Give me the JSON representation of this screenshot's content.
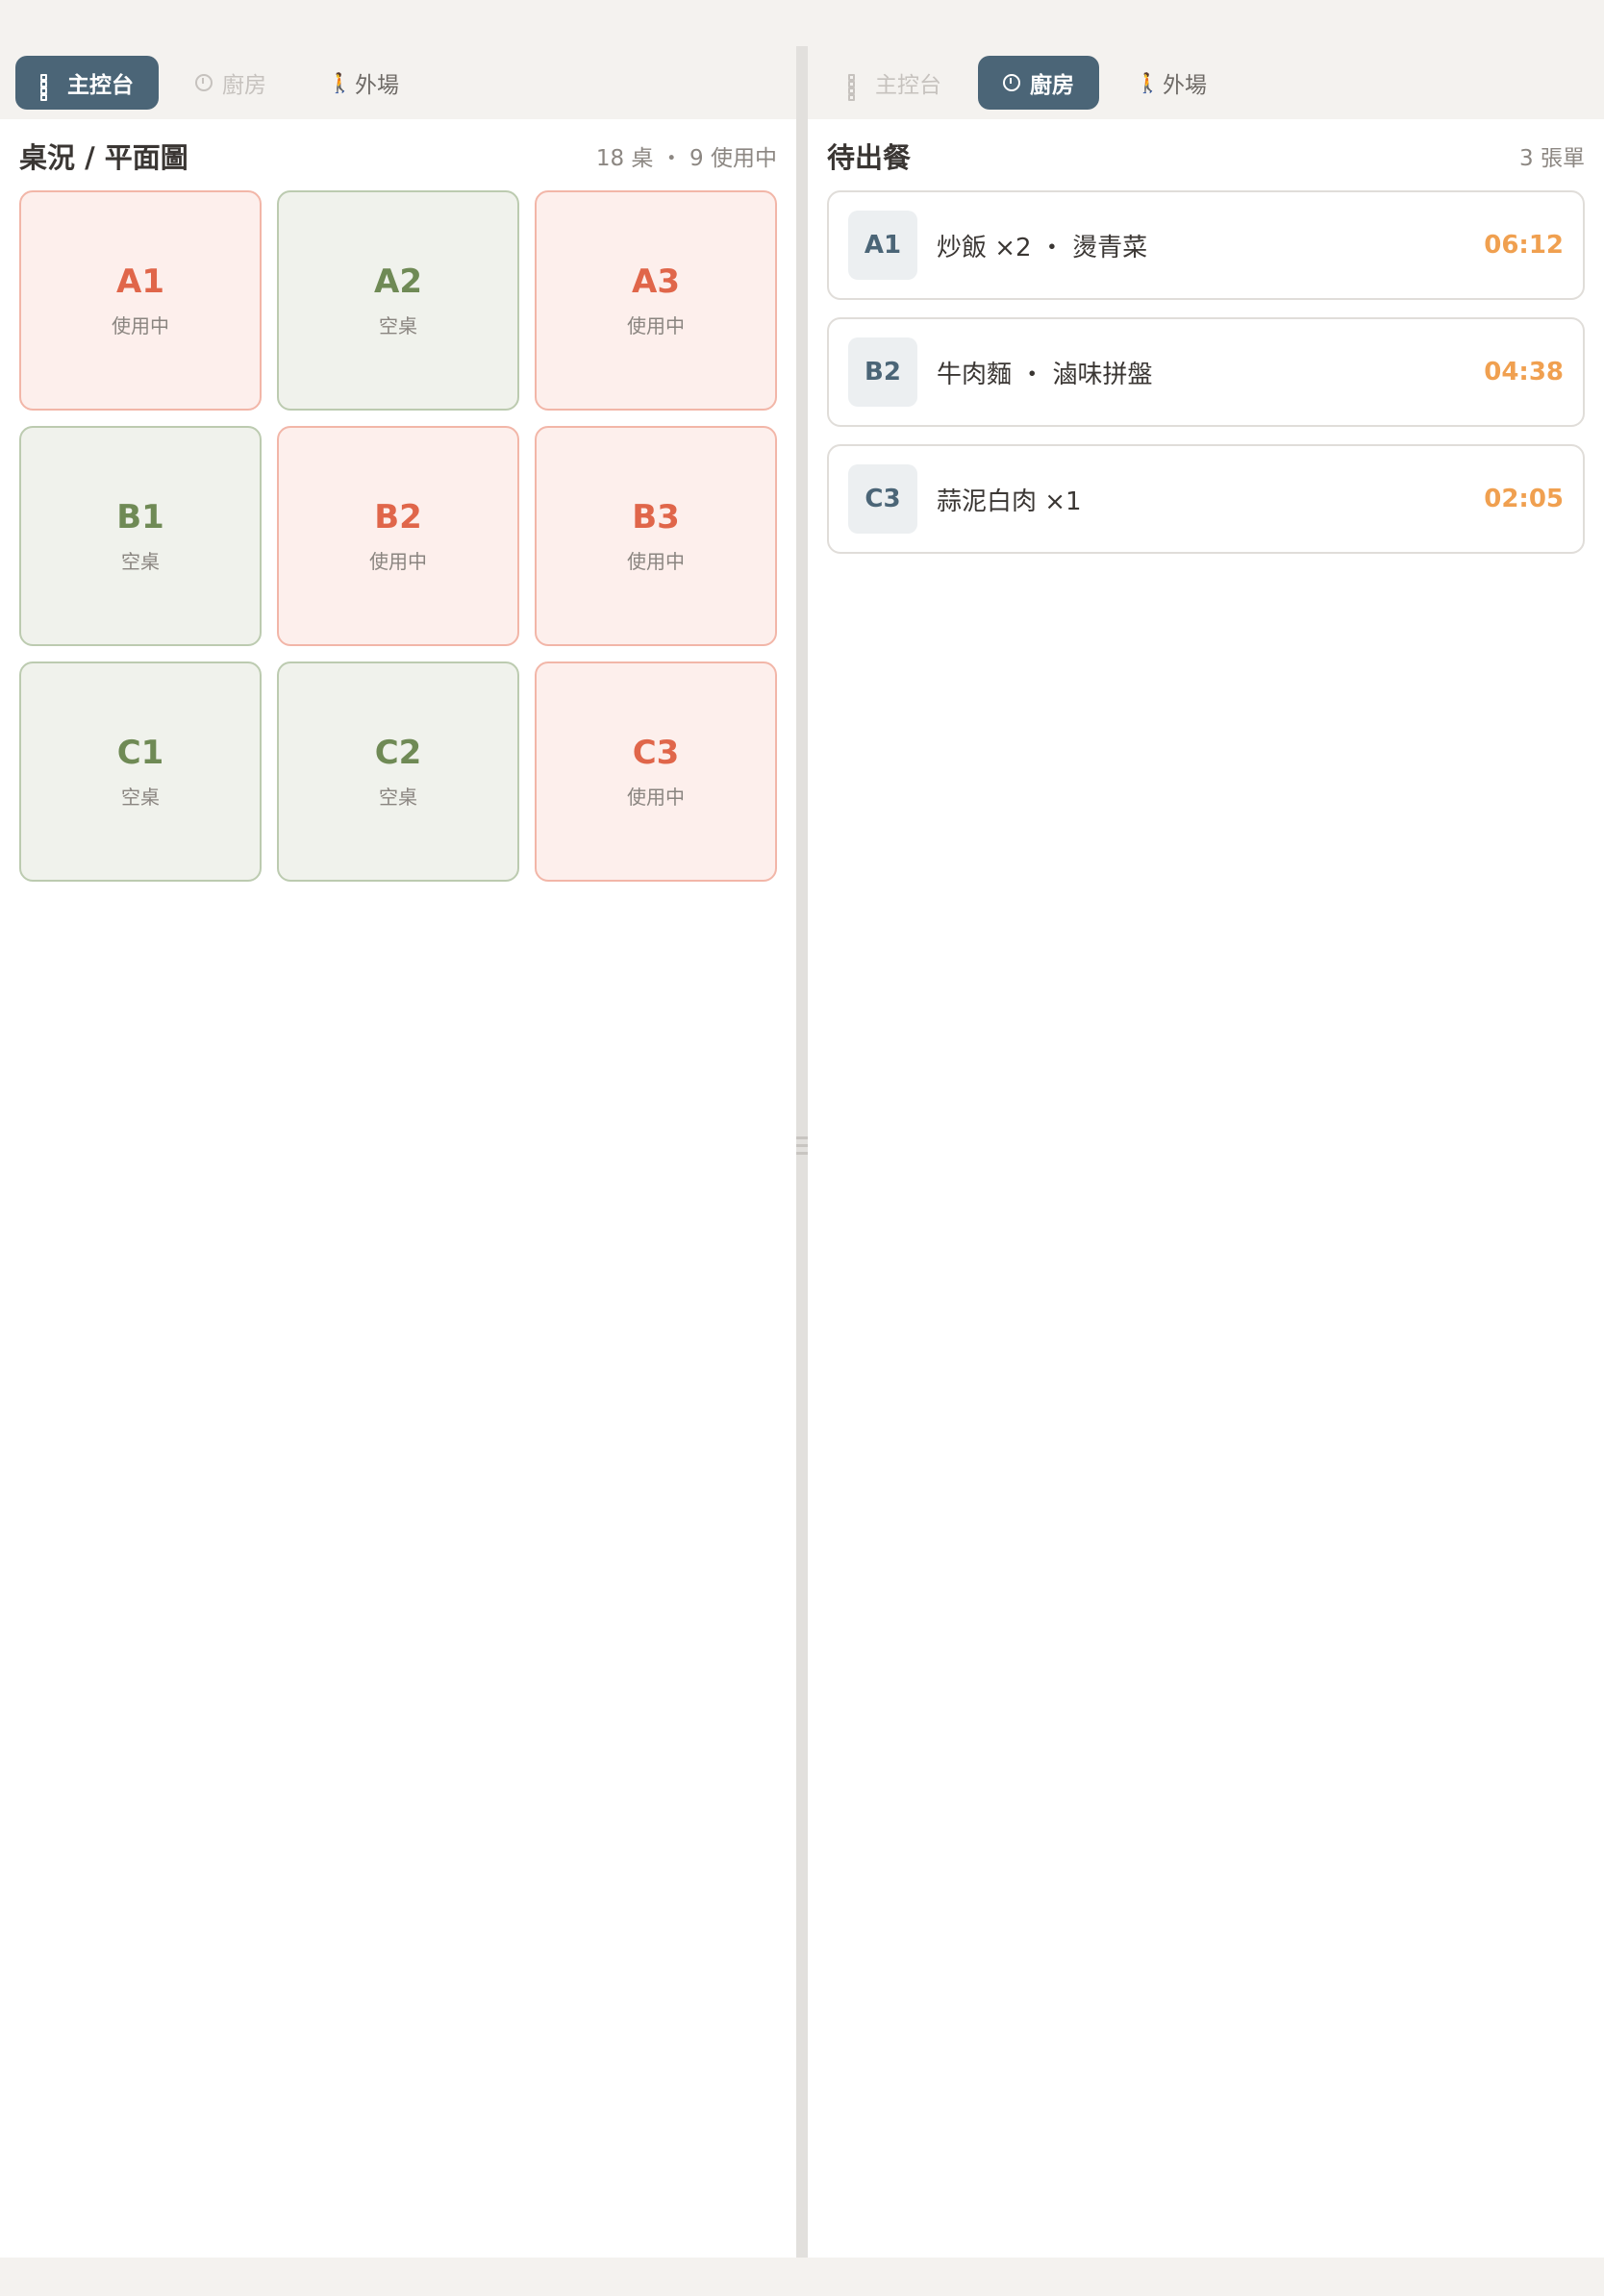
{
  "left_pane": {
    "tabs": [
      {
        "label": "主控台",
        "icon": "grid-icon",
        "state": "active"
      },
      {
        "label": "廚房",
        "icon": "timer-icon",
        "state": "disabled"
      },
      {
        "label": "外場",
        "icon": "walk-icon",
        "state": "normal"
      }
    ],
    "section_title": "桌況 / 平面圖",
    "section_meta": "18 桌 ・ 9 使用中",
    "tables": [
      {
        "id": "A1",
        "status": "使用中",
        "busy": true
      },
      {
        "id": "A2",
        "status": "空桌",
        "busy": false
      },
      {
        "id": "A3",
        "status": "使用中",
        "busy": true
      },
      {
        "id": "B1",
        "status": "空桌",
        "busy": false
      },
      {
        "id": "B2",
        "status": "使用中",
        "busy": true
      },
      {
        "id": "B3",
        "status": "使用中",
        "busy": true
      },
      {
        "id": "C1",
        "status": "空桌",
        "busy": false
      },
      {
        "id": "C2",
        "status": "空桌",
        "busy": false
      },
      {
        "id": "C3",
        "status": "使用中",
        "busy": true
      }
    ]
  },
  "right_pane": {
    "tabs": [
      {
        "label": "主控台",
        "icon": "grid-icon",
        "state": "disabled"
      },
      {
        "label": "廚房",
        "icon": "timer-icon",
        "state": "active"
      },
      {
        "label": "外場",
        "icon": "walk-icon",
        "state": "normal"
      }
    ],
    "section_title": "待出餐",
    "section_meta": "3 張單",
    "orders": [
      {
        "table": "A1",
        "items": "炒飯 ×2 ・ 燙青菜",
        "time": "06:12"
      },
      {
        "table": "B2",
        "items": "牛肉麵 ・ 滷味拼盤",
        "time": "04:38"
      },
      {
        "table": "C3",
        "items": "蒜泥白肉 ×1",
        "time": "02:05"
      }
    ]
  },
  "colors": {
    "accent": "#4b6577",
    "busy": "#e0664a",
    "free": "#6f8a55",
    "timer": "#f0a050"
  }
}
